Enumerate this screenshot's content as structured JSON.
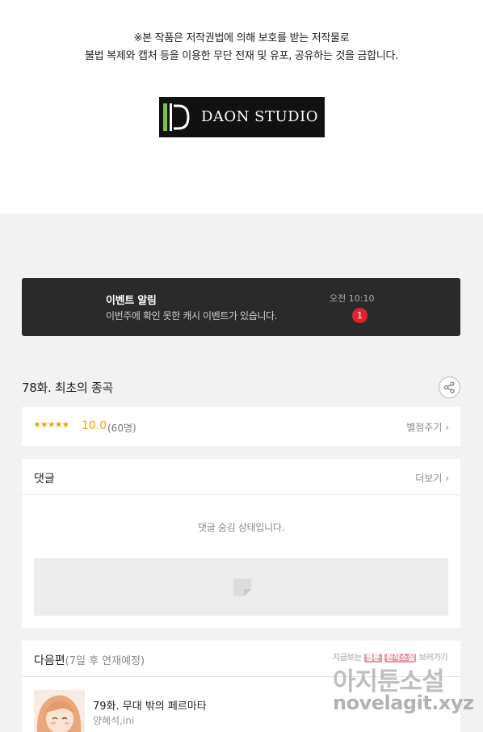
{
  "copyright": {
    "line1": "※본 작품은 저작권법에 의해 보호를 받는 저작물로",
    "line2": "불법 복제와 캡처 등을 이용한 무단 전재 및 유포, 공유하는 것을 금합니다."
  },
  "logo": {
    "text": "DAON STUDIO"
  },
  "event": {
    "title": "이벤트 알림",
    "message": "이번주에 확인 못한 캐시 이벤트가 있습니다.",
    "time": "오전 10:10",
    "badge": "1"
  },
  "episode": {
    "title": "78화. 최초의 종곡",
    "share_icon": "share-icon"
  },
  "rating": {
    "stars": "★★★★★",
    "score": "10.0",
    "count": "(60명)",
    "rate_label": "별점주기 ›"
  },
  "comments": {
    "title": "댓글",
    "more_label": "더보기 ›",
    "hidden_message": "댓글 숨김 상태입니다."
  },
  "next_episode": {
    "header": "다음편",
    "schedule": "(7일 후 연재예정)",
    "title": "79화. 무대 밖의 페르마타",
    "author": "양혜석,ini"
  },
  "watermark": {
    "tagline_pre": "지금보는",
    "tagline_pill1": "웹툰",
    "tagline_mid": "",
    "tagline_pill2": "원작소설",
    "tagline_post": "보러가기",
    "site_name": "아지툰소설",
    "url": "novelagit.xyz"
  },
  "colors": {
    "accent_star": "#f5a200",
    "badge_red": "#e0242b",
    "event_bg": "#2a2a2a",
    "page_bg": "#f2f2f2"
  }
}
